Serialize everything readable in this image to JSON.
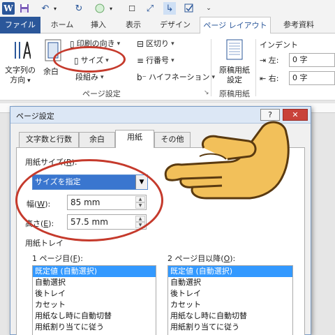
{
  "qat": {
    "icons": [
      "word-icon",
      "save-icon",
      "undo-icon",
      "redo-icon",
      "circle-icon",
      "customize-icon",
      "checkmark-icon",
      "pointer-icon",
      "check-pointer-icon",
      "dropdown-icon"
    ],
    "word_letter": "W"
  },
  "tabs": {
    "items": [
      "ファイル",
      "ホーム",
      "挿入",
      "表示",
      "デザイン",
      "ページ レイアウト",
      "参考資料"
    ],
    "active": "ページ レイアウト"
  },
  "ribbon": {
    "text_direction": "文字列の方向",
    "text_direction_l1": "文字列の",
    "text_direction_l2": "方向",
    "margins": "余白",
    "orientation": "印刷の向き",
    "size": "サイズ",
    "columns": "段組み",
    "breaks": "区切り",
    "line_numbers": "行番号",
    "hyphenation": "ハイフネーション",
    "group_page_setup": "ページ設定",
    "manuscript_l1": "原稿用紙",
    "manuscript_l2": "設定",
    "group_manuscript": "原稿用紙",
    "indent_title": "インデント",
    "indent_left_label": "左:",
    "indent_left_value": "0 字",
    "indent_right_label": "右:",
    "indent_right_value": "0 字"
  },
  "dialog": {
    "title": "ページ設定",
    "help": "?",
    "close": "✕",
    "tabs": [
      "文字数と行数",
      "余白",
      "用紙",
      "その他"
    ],
    "active_tab": "用紙",
    "paper_size_label": "用紙サイズ(",
    "paper_size_key": "R",
    "paper_size_end": "):",
    "paper_size_value": "サイズを指定",
    "width_label": "幅(",
    "width_key": "W",
    "width_end": "):",
    "width_value": "85 mm",
    "height_label": "高さ(",
    "height_key": "E",
    "height_end": "):",
    "height_value": "57.5 mm",
    "tray_label": "用紙トレイ",
    "first_page_label": "1 ページ目(",
    "first_page_key": "F",
    "first_page_end": "):",
    "other_pages_label": "2 ページ目以降(",
    "other_pages_key": "O",
    "other_pages_end": "):",
    "first_page_items": [
      "既定値 (自動選択)",
      "自動選択",
      "後トレイ",
      "カセット",
      "用紙なし時に自動切替",
      "用紙割り当てに従う"
    ],
    "other_pages_items": [
      "既定値 (自動選択)",
      "自動選択",
      "後トレイ",
      "カセット",
      "用紙なし時に自動切替",
      "用紙割り当てに従う"
    ]
  },
  "colors": {
    "accent": "#2b579a",
    "highlight_circle": "#c53a2c",
    "selection": "#3399ff",
    "hand": "#f2c05a"
  }
}
